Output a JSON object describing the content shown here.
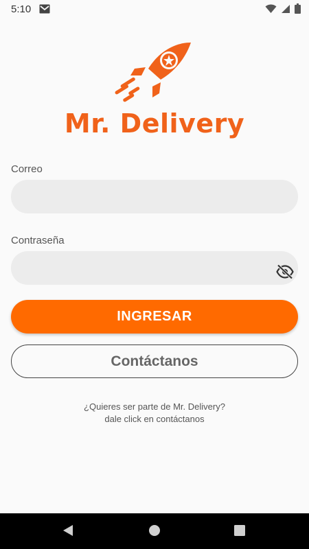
{
  "status_bar": {
    "time": "5:10",
    "icons": [
      "mail-icon",
      "wifi-icon",
      "signal-icon",
      "battery-icon"
    ]
  },
  "logo": {
    "text": "Mr. Delivery",
    "icon": "rocket-icon",
    "color": "#f0621a"
  },
  "login_form": {
    "email_label": "Correo",
    "email_value": "",
    "email_placeholder": "",
    "password_label": "Contraseña",
    "password_value": "",
    "password_placeholder": "",
    "password_toggle_icon": "eye-off-icon",
    "login_button_label": "INGRESAR",
    "contact_button_label": "Contáctanos"
  },
  "info": {
    "line1": "¿Quieres ser parte de Mr. Delivery?",
    "line2": "dale click en contáctanos"
  },
  "nav_bar": {
    "icons": [
      "back-icon",
      "home-icon",
      "recents-icon"
    ]
  },
  "colors": {
    "accent": "#ff6a00",
    "input_bg": "#ececec",
    "background": "#fafafa"
  }
}
